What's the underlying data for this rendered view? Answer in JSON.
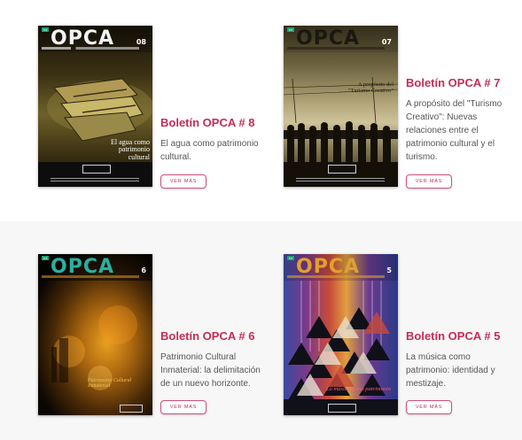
{
  "items": [
    {
      "title": "Boletín OPCA # 8",
      "description": "El agua como patrimonio cultural.",
      "button_label": "VER MÁS",
      "cover": {
        "brand": "OPCA",
        "number": "08",
        "headline": "El agua como patrimonio cultural",
        "palette": [
          "#2a2410",
          "#8a7a3a",
          "#c8b86a"
        ]
      }
    },
    {
      "title": "Boletín OPCA # 7",
      "description": "A propósito del \"Turismo Creativo\": Nuevas relaciones entre el patrimonio cultural y el turismo.",
      "button_label": "VER MÁS",
      "cover": {
        "brand": "OPCA",
        "number": "07",
        "headline": "A propósito del \"Turismo Creativo\"",
        "palette": [
          "#1e1a10",
          "#9a8e6a",
          "#d8ceb0"
        ]
      }
    },
    {
      "title": "Boletín OPCA # 6",
      "description": "Patrimonio Cultural Inmaterial: la delimitación de un nuevo horizonte.",
      "button_label": "VER MÁS",
      "cover": {
        "brand": "OPCA",
        "number": "6",
        "headline": "Patrimonio Cultural Inmaterial",
        "palette": [
          "#0a0602",
          "#7a4a08",
          "#e8a020"
        ]
      }
    },
    {
      "title": "Boletín OPCA # 5",
      "description": "La música como patrimonio: identidad y mestizaje.",
      "button_label": "VER MÁS",
      "cover": {
        "brand": "OPCA",
        "number": "5",
        "headline": "La música como patrimonio",
        "palette": [
          "#6a2a5a",
          "#d04a3a",
          "#3a5aa8"
        ]
      }
    }
  ]
}
